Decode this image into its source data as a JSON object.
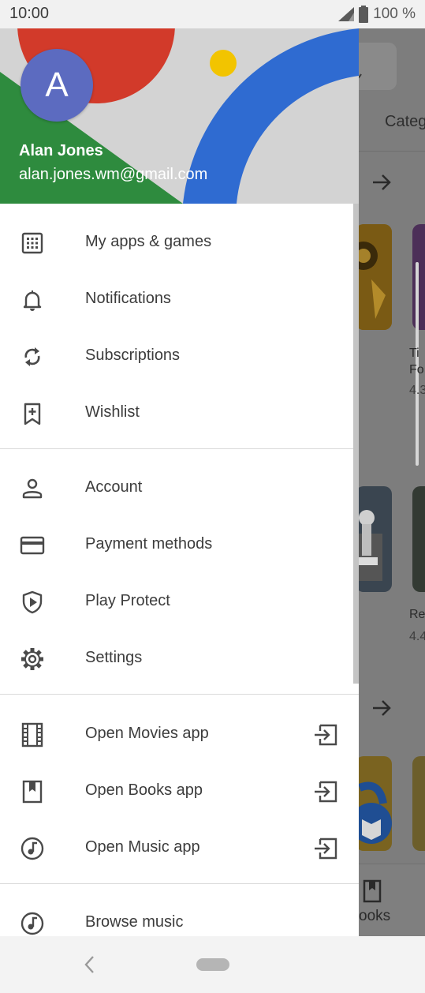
{
  "status_bar": {
    "time": "10:00",
    "battery": "100 %"
  },
  "drawer": {
    "header": {
      "avatar_letter": "A",
      "name": "Alan Jones",
      "email": "alan.jones.wm@gmail.com"
    },
    "sections": [
      [
        {
          "label": "My apps & games",
          "icon": "grid-apps-icon"
        },
        {
          "label": "Notifications",
          "icon": "bell-icon"
        },
        {
          "label": "Subscriptions",
          "icon": "refresh-icon"
        },
        {
          "label": "Wishlist",
          "icon": "bookmark-plus-icon"
        }
      ],
      [
        {
          "label": "Account",
          "icon": "person-icon"
        },
        {
          "label": "Payment methods",
          "icon": "credit-card-icon"
        },
        {
          "label": "Play Protect",
          "icon": "shield-play-icon"
        },
        {
          "label": "Settings",
          "icon": "gear-icon"
        }
      ],
      [
        {
          "label": "Open Movies app",
          "icon": "film-icon",
          "trailing": "open-external-icon"
        },
        {
          "label": "Open Books app",
          "icon": "book-icon",
          "trailing": "open-external-icon"
        },
        {
          "label": "Open Music app",
          "icon": "music-note-icon",
          "trailing": "open-external-icon"
        }
      ],
      [
        {
          "label": "Browse music",
          "icon": "music-note-icon"
        }
      ]
    ]
  },
  "background_app": {
    "tab_partial": "Categ",
    "card_text_1": "Ti",
    "card_text_2": "Fo",
    "card_rating_1": "4.3",
    "card_text_3": "Re",
    "card_rating_2": "4.4",
    "bottom_tab_partial": "ooks"
  },
  "colors": {
    "header_green": "#2e8b3e",
    "header_red": "#d23a2a",
    "header_blue": "#2f6bd1",
    "header_yellow": "#f2c400",
    "avatar": "#5c6bc0",
    "icon": "#4a4a4a",
    "text": "#3c3c3c"
  }
}
